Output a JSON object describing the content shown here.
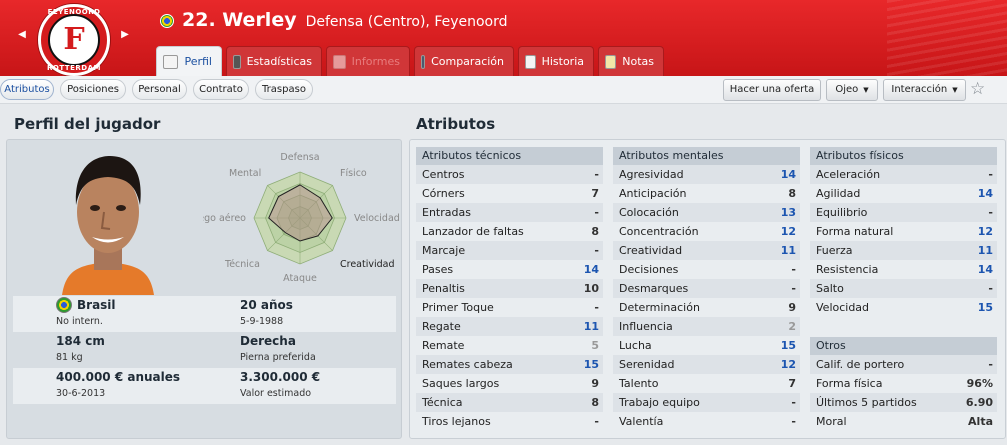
{
  "header": {
    "club_logo_text": {
      "top": "FEYENOORD",
      "bottom": "ROTTERDAM"
    },
    "player_number_name": "22. Werley",
    "player_desc": "Defensa (Centro), Feyenoord"
  },
  "tabs": [
    {
      "label": "Perfil",
      "active": true
    },
    {
      "label": "Estadísticas"
    },
    {
      "label": "Informes",
      "disabled": true
    },
    {
      "label": "Comparación"
    },
    {
      "label": "Historia"
    },
    {
      "label": "Notas"
    }
  ],
  "subtabs": [
    "Atributos",
    "Posiciones",
    "Personal",
    "Contrato",
    "Traspaso"
  ],
  "actions": {
    "offer": "Hacer una oferta",
    "scout": "Ojeo",
    "interaction": "Interacción"
  },
  "profile": {
    "title": "Perfil del jugador",
    "radar_labels": {
      "top": "Defensa",
      "top_right": "Físico",
      "right": "Velocidad",
      "bottom_right": "Creatividad",
      "bottom": "Ataque",
      "bottom_left": "Técnica",
      "left": "Juego aéreo",
      "top_left": "Mental"
    },
    "radar_values": {
      "defensa": 0.72,
      "fisico": 0.62,
      "velocidad": 0.7,
      "creatividad": 0.55,
      "ataque": 0.5,
      "tecnica": 0.45,
      "juego_aereo": 0.68,
      "mental": 0.66
    },
    "nationality": "Brasil",
    "intl": "No intern.",
    "age": "20 años",
    "dob": "5-9-1988",
    "height": "184 cm",
    "weight": "81 kg",
    "foot": "Derecha",
    "foot_label": "Pierna preferida",
    "wage": "400.000 € anuales",
    "contract_end": "30-6-2013",
    "value": "3.300.000 €",
    "value_label": "Valor estimado"
  },
  "attributes": {
    "title": "Atributos",
    "technical": {
      "title": "Atributos técnicos",
      "rows": [
        [
          "Centros",
          "-"
        ],
        [
          "Córners",
          "7"
        ],
        [
          "Entradas",
          "-"
        ],
        [
          "Lanzador de faltas",
          "8"
        ],
        [
          "Marcaje",
          "-"
        ],
        [
          "Pases",
          "14"
        ],
        [
          "Penaltis",
          "10"
        ],
        [
          "Primer Toque",
          "-"
        ],
        [
          "Regate",
          "11"
        ],
        [
          "Remate",
          "5"
        ],
        [
          "Remates cabeza",
          "15"
        ],
        [
          "Saques largos",
          "9"
        ],
        [
          "Técnica",
          "8"
        ],
        [
          "Tiros lejanos",
          "-"
        ]
      ]
    },
    "mental": {
      "title": "Atributos mentales",
      "rows": [
        [
          "Agresividad",
          "14"
        ],
        [
          "Anticipación",
          "8"
        ],
        [
          "Colocación",
          "13"
        ],
        [
          "Concentración",
          "12"
        ],
        [
          "Creatividad",
          "11"
        ],
        [
          "Decisiones",
          "-"
        ],
        [
          "Desmarques",
          "-"
        ],
        [
          "Determinación",
          "9"
        ],
        [
          "Influencia",
          "2"
        ],
        [
          "Lucha",
          "15"
        ],
        [
          "Serenidad",
          "12"
        ],
        [
          "Talento",
          "7"
        ],
        [
          "Trabajo equipo",
          "-"
        ],
        [
          "Valentía",
          "-"
        ]
      ]
    },
    "physical": {
      "title": "Atributos físicos",
      "rows": [
        [
          "Aceleración",
          "-"
        ],
        [
          "Agilidad",
          "14"
        ],
        [
          "Equilibrio",
          "-"
        ],
        [
          "Forma natural",
          "12"
        ],
        [
          "Fuerza",
          "11"
        ],
        [
          "Resistencia",
          "14"
        ],
        [
          "Salto",
          "-"
        ],
        [
          "Velocidad",
          "15"
        ]
      ]
    },
    "other": {
      "title": "Otros",
      "rows": [
        [
          "Calif. de portero",
          "-"
        ],
        [
          "Forma física",
          "96%"
        ],
        [
          "Últimos 5 partidos",
          "6.90"
        ],
        [
          "Moral",
          "Alta"
        ]
      ]
    }
  },
  "colors": {
    "header_red": "#d41b1d",
    "highlight_blue": "#1c55b0"
  }
}
